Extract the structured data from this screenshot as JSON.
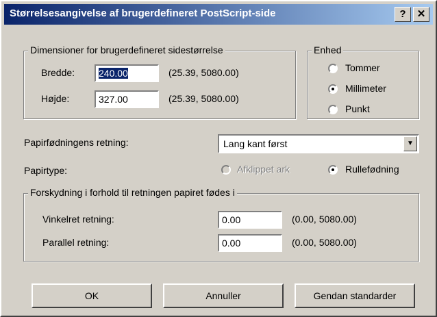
{
  "window": {
    "title": "Størrelsesangivelse af brugerdefineret PostScript-side",
    "help_label": "?",
    "close_label": "✕"
  },
  "dimensions": {
    "legend": "Dimensioner for brugerdefineret sidestørrelse",
    "width_label": "Bredde:",
    "width_value": "240.00",
    "width_range": "(25.39, 5080.00)",
    "height_label": "Højde:",
    "height_value": "327.00",
    "height_range": "(25.39, 5080.00)"
  },
  "unit": {
    "legend": "Enhed",
    "options": [
      {
        "label": "Tommer",
        "checked": false
      },
      {
        "label": "Millimeter",
        "checked": true
      },
      {
        "label": "Punkt",
        "checked": false
      }
    ]
  },
  "feed": {
    "direction_label": "Papirfødningens retning:",
    "direction_value": "Lang kant først",
    "papertype_label": "Papirtype:",
    "papertype_options": [
      {
        "label": "Afklippet ark",
        "checked": false,
        "disabled": true
      },
      {
        "label": "Rullefødning",
        "checked": true,
        "disabled": false
      }
    ]
  },
  "offset": {
    "legend": "Forskydning i forhold til retningen papiret fødes i",
    "perp_label": "Vinkelret retning:",
    "perp_value": "0.00",
    "perp_range": "(0.00, 5080.00)",
    "par_label": "Parallel retning:",
    "par_value": "0.00",
    "par_range": "(0.00, 5080.00)"
  },
  "buttons": {
    "ok": "OK",
    "cancel": "Annuller",
    "restore": "Gendan standarder"
  }
}
